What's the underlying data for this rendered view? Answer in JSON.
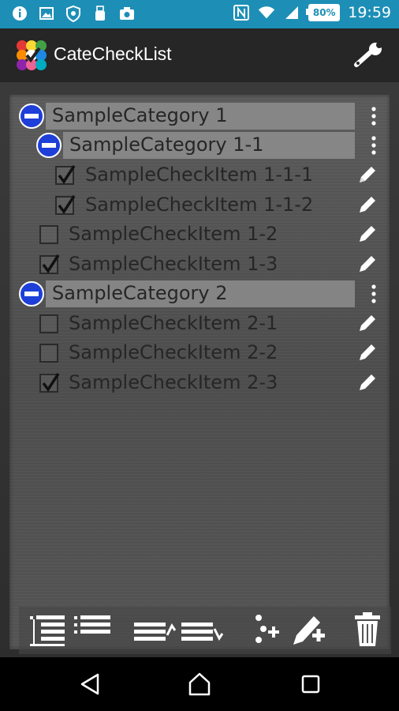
{
  "status_bar": {
    "battery": "80%",
    "time": "19:59",
    "left_icons": [
      "info-icon",
      "image-icon",
      "shield-icon",
      "usb-icon",
      "camera-icon"
    ],
    "right_icons": [
      "nfc-icon",
      "wifi-icon",
      "signal-icon",
      "battery-icon"
    ]
  },
  "app_bar": {
    "title": "CateCheckList",
    "settings_icon": "wrench-icon"
  },
  "list": {
    "items": [
      {
        "kind": "category",
        "level": 0,
        "label": "SampleCategory 1"
      },
      {
        "kind": "category",
        "level": 1,
        "label": "SampleCategory 1-1"
      },
      {
        "kind": "item",
        "level": 2,
        "label": "SampleCheckItem 1-1-1",
        "checked": true
      },
      {
        "kind": "item",
        "level": 2,
        "label": "SampleCheckItem 1-1-2",
        "checked": true
      },
      {
        "kind": "item",
        "level": 1,
        "label": "SampleCheckItem 1-2",
        "checked": false
      },
      {
        "kind": "item",
        "level": 1,
        "label": "SampleCheckItem 1-3",
        "checked": true
      },
      {
        "kind": "category",
        "level": 0,
        "label": "SampleCategory 2"
      },
      {
        "kind": "item",
        "level": 1,
        "label": "SampleCheckItem 2-1",
        "checked": false
      },
      {
        "kind": "item",
        "level": 1,
        "label": "SampleCheckItem 2-2",
        "checked": false
      },
      {
        "kind": "item",
        "level": 1,
        "label": "SampleCheckItem 2-3",
        "checked": true
      }
    ]
  },
  "toolbar": {
    "buttons": [
      "expand-all-icon",
      "collapse-all-icon",
      "move-up-icon",
      "move-down-icon",
      "add-category-icon",
      "add-item-icon",
      "trash-icon"
    ]
  },
  "colors": {
    "status_bar": "#1d8fb6",
    "action_bar": "#262626",
    "minus_badge": "#1e3fd8"
  }
}
